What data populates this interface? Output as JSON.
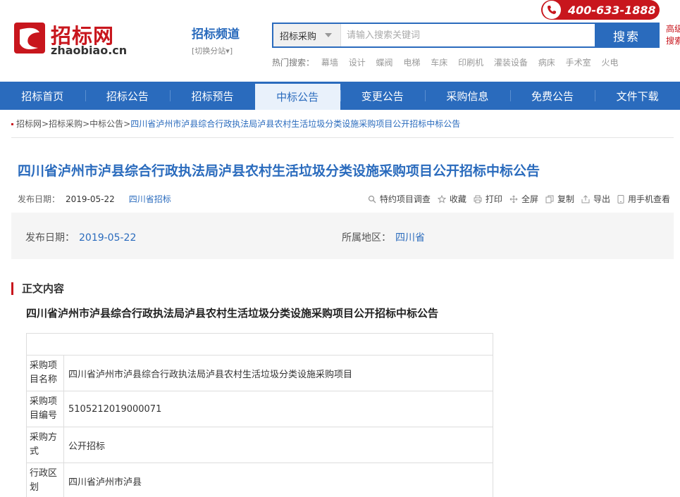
{
  "colors": {
    "brand_red": "#c8161d",
    "brand_blue": "#2a6bbd",
    "light_bg": "#f5f5f5"
  },
  "header": {
    "logo_cn": "招标网",
    "logo_en": "zhaobiao.cn",
    "channel_title": "招标频道",
    "channel_switch": "[切换分站▾]",
    "phone": "400-633-1888",
    "search": {
      "category": "招标采购",
      "placeholder": "请输入搜索关键词",
      "button": "搜索"
    },
    "adv_search": [
      "高级",
      "搜索"
    ],
    "hot_label": "热门搜索：",
    "hot_terms": [
      "幕墙",
      "设计",
      "蝶阀",
      "电梯",
      "车床",
      "印刷机",
      "灌装设备",
      "病床",
      "手术室",
      "火电"
    ]
  },
  "nav": {
    "items": [
      "招标首页",
      "招标公告",
      "招标预告",
      "中标公告",
      "变更公告",
      "采购信息",
      "免费公告",
      "文件下载"
    ],
    "active_index": 3
  },
  "breadcrumb": {
    "items": [
      "招标网",
      "招标采购",
      "中标公告"
    ],
    "current": "四川省泸州市泸县综合行政执法局泸县农村生活垃圾分类设施采购项目公开招标中标公告"
  },
  "article": {
    "title": "四川省泸州市泸县综合行政执法局泸县农村生活垃圾分类设施采购项目公开招标中标公告",
    "publish_label": "发布日期：",
    "publish_date": "2019-05-22",
    "region_tag": "四川省招标",
    "tools": [
      "特约项目调查",
      "收藏",
      "打印",
      "全屏",
      "复制",
      "导出",
      "用手机查看"
    ],
    "info": {
      "date_label": "发布日期：",
      "date_value": "2019-05-22",
      "area_label": "所属地区：",
      "area_value": "四川省"
    },
    "section_label": "正文内容",
    "doc_title": "四川省泸州市泸县综合行政执法局泸县农村生活垃圾分类设施采购项目公开招标中标公告",
    "table": [
      {
        "key": "采购项目名称",
        "value": "四川省泸州市泸县综合行政执法局泸县农村生活垃圾分类设施采购项目"
      },
      {
        "key": "采购项目编号",
        "value": "5105212019000071"
      },
      {
        "key": "采购方式",
        "value": "公开招标"
      },
      {
        "key": "行政区划",
        "value": "四川省泸州市泸县"
      }
    ]
  }
}
